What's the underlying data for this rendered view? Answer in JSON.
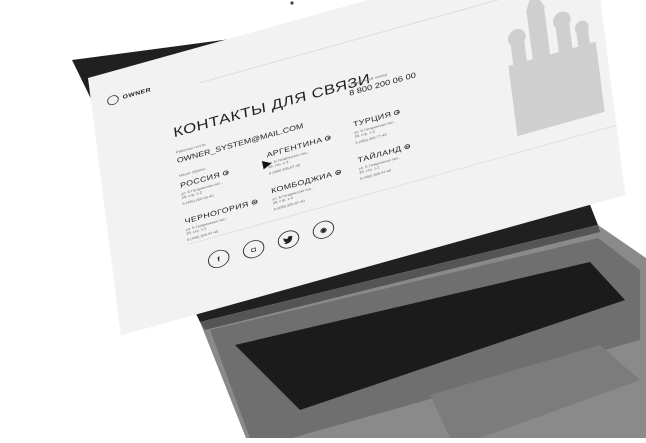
{
  "brand": {
    "name": "OWNER"
  },
  "page": {
    "title": "КОНТАКТЫ ДЛЯ СВЯЗИ"
  },
  "contacts": {
    "email_label": "Рабочая почта",
    "email": "OWNER_SYSTEM@MAIL.COM",
    "phone_label": "Справочный номер",
    "phone": "8 800 200 06 00"
  },
  "offices_label": "Наши офисы",
  "offices": [
    {
      "country": "РОССИЯ",
      "address": "ул. Б.Гагаринская пос., 28, стр. 1-2",
      "phone": "8 (495) 205-95-40"
    },
    {
      "country": "АРГЕНТИНА",
      "address": "ул. Б.Гагаринская пос., 28, стр. 1-2",
      "phone": "8 (495) 205-97-40"
    },
    {
      "country": "ТУРЦИЯ",
      "address": "ул. Б.Гагаринская пос., 28, стр. 1-2",
      "phone": "8 (495) 205-77-40"
    },
    {
      "country": "ЧЕРНОГОРИЯ",
      "address": "ул. Б.Гагаринская пос., 28, стр. 1-2",
      "phone": "8 (495) 205-97-40"
    },
    {
      "country": "КОМБОДЖИА",
      "address": "ул. Б.Гагаринская пос., 28, стр. 1-2",
      "phone": "8 (495) 205-97-40"
    },
    {
      "country": "ТАЙЛАНД",
      "address": "ул. Б.Гагаринская пос., 28, стр. 1-2",
      "phone": "8 (495) 205-97-40"
    }
  ],
  "socials": [
    {
      "icon": "facebook-icon",
      "glyph": "f"
    },
    {
      "icon": "instagram-icon",
      "glyph": "◘"
    },
    {
      "icon": "twitter-icon",
      "glyph": "🐦"
    },
    {
      "icon": "discord-icon",
      "glyph": "◉"
    }
  ],
  "colors": {
    "screen_bg": "#f2f2f2",
    "laptop_body": "#2b2b2b",
    "keyboard": "#1a1a1a",
    "base": "#7a7a7a"
  }
}
